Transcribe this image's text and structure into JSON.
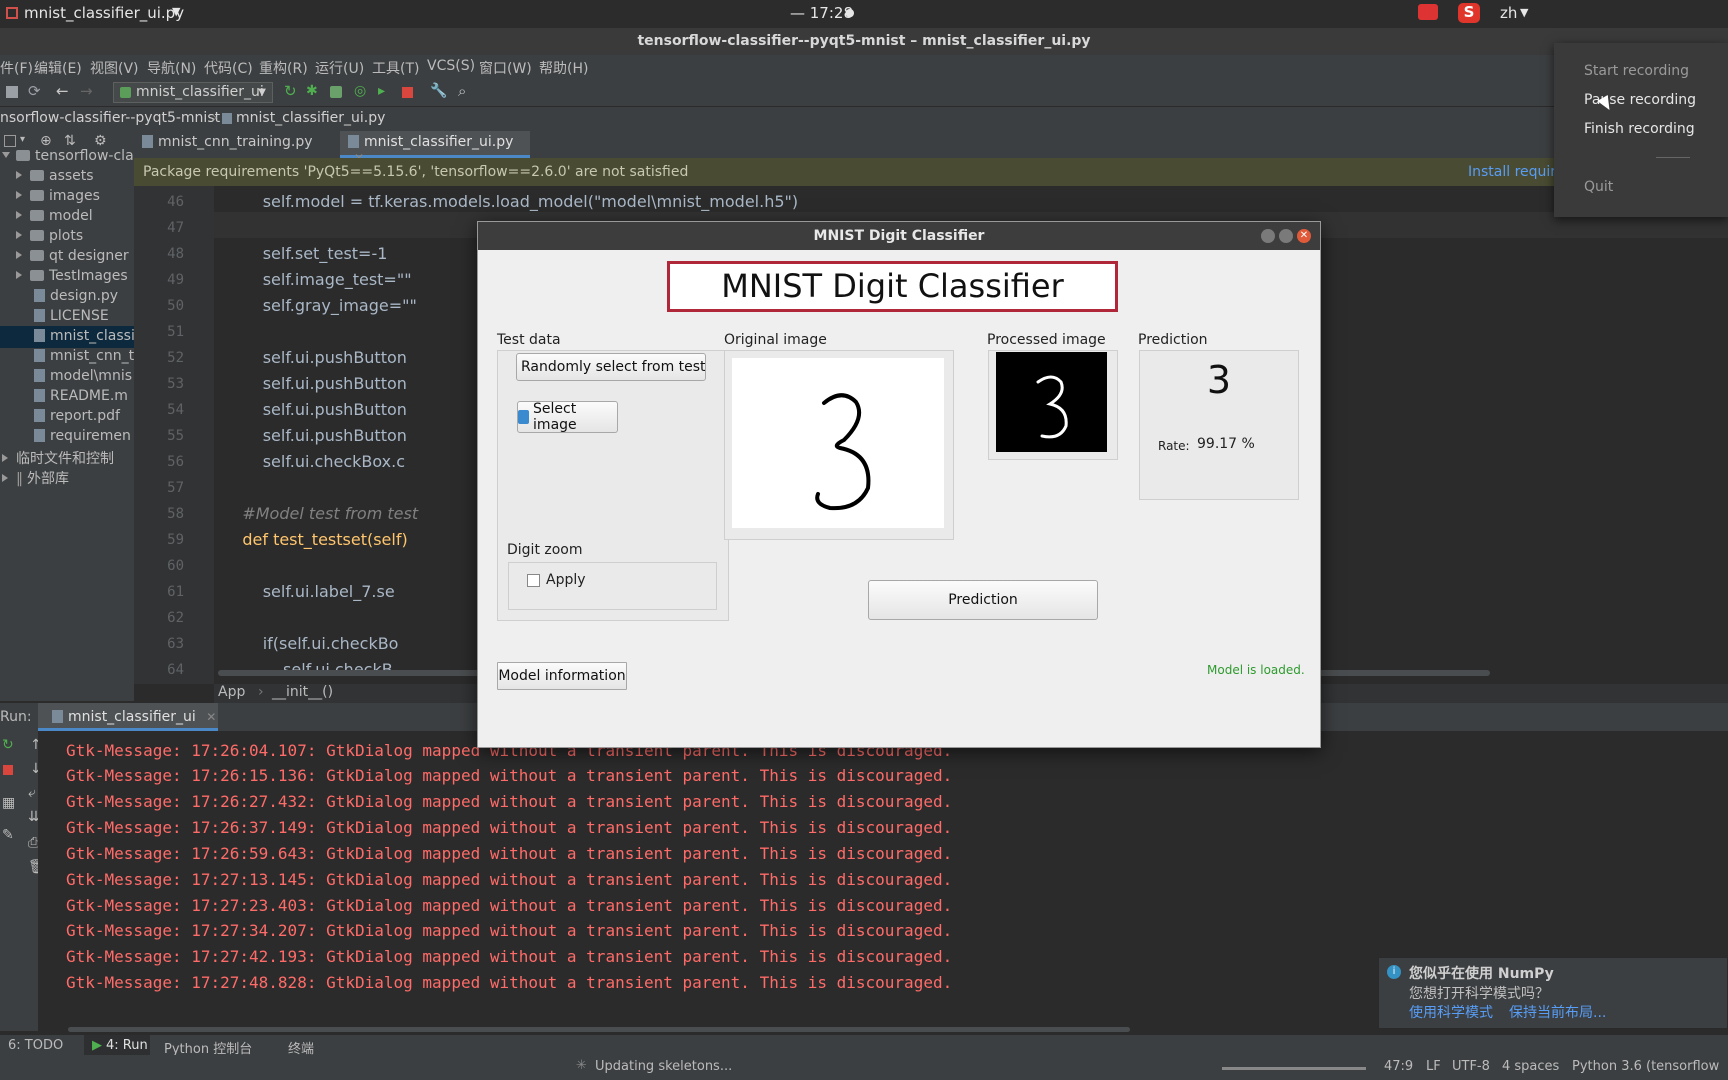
{
  "topbar": {
    "app_menu": "mnist_classifier_ui.py",
    "clock": "— 17:28",
    "lang": "zh"
  },
  "window_title": "tensorflow-classifier--pyqt5-mnist – mnist_classifier_ui.py",
  "menus": [
    "件(F)",
    "编辑(E)",
    "视图(V)",
    "导航(N)",
    "代码(C)",
    "重构(R)",
    "运行(U)",
    "工具(T)",
    "VCS(S)",
    "窗口(W)",
    "帮助(H)"
  ],
  "toolbar": {
    "run_config": "mnist_classifier_ui"
  },
  "breadcrumb": {
    "project": "nsorflow-classifier--pyqt5-mnist",
    "file": "mnist_classifier_ui.py"
  },
  "tabs": [
    {
      "label": "mnist_cnn_training.py"
    },
    {
      "label": "mnist_classifier_ui.py"
    }
  ],
  "warning": {
    "text": "Package requirements 'PyQt5==5.15.6', 'tensorflow==2.6.0' are not satisfied",
    "action": "Install requir"
  },
  "tree": {
    "root": "tensorflow-cla",
    "folders": [
      "assets",
      "images",
      "model",
      "plots",
      "qt designer",
      "TestImages"
    ],
    "files": [
      "design.py",
      "LICENSE",
      "mnist_classi",
      "mnist_cnn_t",
      "model\\mnis",
      "README.m",
      "report.pdf",
      "requiremen"
    ],
    "scratch": "临时文件和控制",
    "external": "外部库"
  },
  "code": {
    "line_numbers": [
      "46",
      "47",
      "48",
      "49",
      "50",
      "51",
      "52",
      "53",
      "54",
      "55",
      "56",
      "57",
      "58",
      "59",
      "60",
      "61",
      "62",
      "63",
      "64"
    ],
    "lines": [
      "        self.model = tf.keras.models.load_model(\"model\\mnist_model.h5\")",
      "",
      "        self.set_test=-1",
      "        self.image_test=\"\"",
      "        self.gray_image=\"\"",
      "",
      "        self.ui.pushButton",
      "        self.ui.pushButton",
      "        self.ui.pushButton",
      "        self.ui.pushButton",
      "        self.ui.checkBox.c",
      "",
      "    #Model test from test",
      "    def test_testset(self)",
      "",
      "        self.ui.label_7.se",
      "",
      "        if(self.ui.checkBo",
      "            self.ui.checkB"
    ],
    "crumb_class": "App",
    "crumb_method": "__init__()"
  },
  "run": {
    "label": "Run:",
    "tab": "mnist_classifier_ui",
    "messages": [
      "Gtk-Message: 17:26:04.107: GtkDialog mapped without a transient parent. This is discouraged.",
      "Gtk-Message: 17:26:15.136: GtkDialog mapped without a transient parent. This is discouraged.",
      "Gtk-Message: 17:26:27.432: GtkDialog mapped without a transient parent. This is discouraged.",
      "Gtk-Message: 17:26:37.149: GtkDialog mapped without a transient parent. This is discouraged.",
      "Gtk-Message: 17:26:59.643: GtkDialog mapped without a transient parent. This is discouraged.",
      "Gtk-Message: 17:27:13.145: GtkDialog mapped without a transient parent. This is discouraged.",
      "Gtk-Message: 17:27:23.403: GtkDialog mapped without a transient parent. This is discouraged.",
      "Gtk-Message: 17:27:34.207: GtkDialog mapped without a transient parent. This is discouraged.",
      "Gtk-Message: 17:27:42.193: GtkDialog mapped without a transient parent. This is discouraged.",
      "Gtk-Message: 17:27:48.828: GtkDialog mapped without a transient parent. This is discouraged."
    ]
  },
  "bottom_tools": [
    "6: TODO",
    "4: Run",
    "Python 控制台",
    "终端"
  ],
  "status": {
    "task": "Updating skeletons...",
    "position": "47:9",
    "line_sep": "LF",
    "encoding": "UTF-8",
    "indent": "4 spaces",
    "interpreter": "Python 3.6 (tensorflow"
  },
  "recording_menu": [
    "Start recording",
    "Pause recording",
    "Finish recording",
    "Quit"
  ],
  "toast": {
    "title": "您似乎在使用 NumPy",
    "body": "您想打开科学模式吗？",
    "link1": "使用科学模式",
    "link2": "保持当前布局..."
  },
  "dialog": {
    "window_title": "MNIST Digit Classifier",
    "heading": "MNIST Digit Classifier",
    "test_data_label": "Test data",
    "random_button": "Randomly select from test s",
    "select_image_button": "Select image",
    "digit_zoom_label": "Digit zoom",
    "apply_label": "Apply",
    "original_label": "Original image",
    "processed_label": "Processed image",
    "prediction_label": "Prediction",
    "predicted_digit": "3",
    "rate_label": "Rate:",
    "rate_value": "99.17 %",
    "predict_button": "Prediction",
    "model_info_button": "Model information",
    "status": "Model is loaded.",
    "digit_shown": "3"
  },
  "colors": {
    "accent_red": "#b0273a",
    "status_green": "#2e9a2e",
    "console_red": "#ff6b68",
    "link_blue": "#589df6"
  }
}
